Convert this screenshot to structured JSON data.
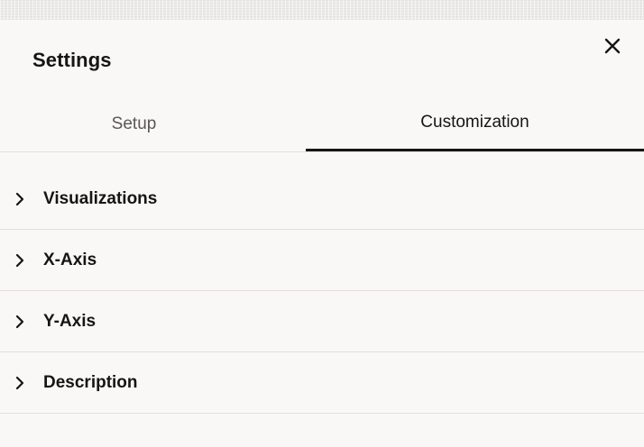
{
  "dialog": {
    "title": "Settings",
    "close_icon": "close-icon"
  },
  "tabs": [
    {
      "label": "Setup",
      "selected": false
    },
    {
      "label": "Customization",
      "selected": true
    }
  ],
  "sections": [
    {
      "label": "Visualizations",
      "icon": "chevron-right-icon",
      "expanded": false
    },
    {
      "label": "X-Axis",
      "icon": "chevron-right-icon",
      "expanded": false
    },
    {
      "label": "Y-Axis",
      "icon": "chevron-right-icon",
      "expanded": false
    },
    {
      "label": "Description",
      "icon": "chevron-right-icon",
      "expanded": false
    }
  ],
  "colors": {
    "text": "#161513",
    "muted_text": "#5a5753",
    "background": "#f9f8f6",
    "divider": "#e2dfdb",
    "active_tab_indicator": "#161513"
  }
}
